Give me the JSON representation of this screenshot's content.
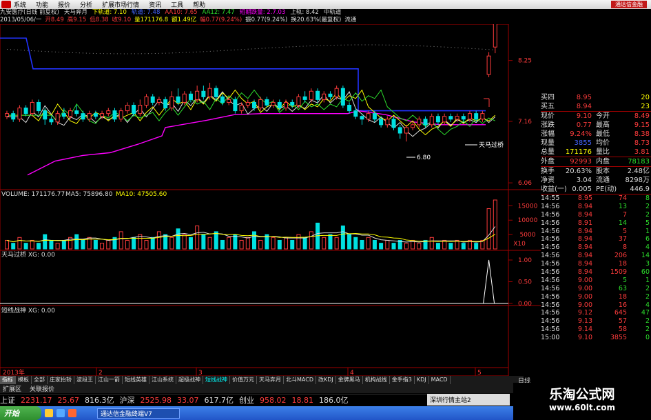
{
  "menu": {
    "items": [
      "系统",
      "功能",
      "报价",
      "分析",
      "扩展市场行情",
      "资讯",
      "工具",
      "帮助"
    ],
    "brand": "通达信金融"
  },
  "header": {
    "line1": [
      {
        "text": "九安医疗(日线 前复权)",
        "c": "w"
      },
      {
        "text": "天马奔月",
        "c": "w"
      },
      {
        "text": "下轨道: 7.10",
        "c": "y"
      },
      {
        "text": "轨道: 7.48",
        "c": "b"
      },
      {
        "text": "AA10: 7.65",
        "c": "r"
      },
      {
        "text": "AA12: 7.47",
        "c": "g"
      },
      {
        "text": "短期跌量: 2.7.03",
        "c": "m"
      },
      {
        "text": "上轨: 8.42",
        "c": "w"
      },
      {
        "text": "中轨道",
        "c": "w"
      }
    ],
    "line2": [
      {
        "text": "2013/05/06/一",
        "c": "w"
      },
      {
        "text": "开8.49",
        "c": "r"
      },
      {
        "text": "高9.15",
        "c": "r"
      },
      {
        "text": "低8.38",
        "c": "r"
      },
      {
        "text": "收9.10",
        "c": "r"
      },
      {
        "text": "量171176.8",
        "c": "y"
      },
      {
        "text": "额1.49亿",
        "c": "y"
      },
      {
        "text": "幅0.77(9.24%)",
        "c": "r"
      },
      {
        "text": "振0.77(9.24%)",
        "c": "w"
      },
      {
        "text": "换20.63%(最复权)",
        "c": "w"
      },
      {
        "text": "流通",
        "c": "w"
      }
    ]
  },
  "price_axis": [
    "8.25",
    "7.16",
    "6.06"
  ],
  "volume_axis": [
    "15000",
    "10000",
    "5000",
    "X10"
  ],
  "xg_axis": [
    "1.00",
    "0.50",
    "0.00"
  ],
  "labels": {
    "volume": "VOLUME: 171176.77",
    "ma5": "MA5: 75896.80",
    "ma10": "MA10: 47505.60",
    "tianma": "天马过桥 XG: 0.00",
    "duanxian": "短线战神 XG: 0.00",
    "annot_tianma": "天马过桥",
    "price_low": "6.80",
    "year": "2013年",
    "months": [
      "2",
      "3",
      "4",
      "5"
    ]
  },
  "panel": {
    "buy_rows": [
      {
        "label": "买四",
        "v1": "8.95",
        "c1": "r",
        "v2": "20",
        "c2": "y"
      },
      {
        "label": "买五",
        "v1": "8.94",
        "c1": "r",
        "v2": "23",
        "c2": "y"
      }
    ],
    "info_rows": [
      {
        "l1": "现价",
        "v1": "9.10",
        "c1": "r",
        "l2": "今开",
        "v2": "8.49",
        "c2": "r"
      },
      {
        "l1": "涨跌",
        "v1": "0.77",
        "c1": "r",
        "l2": "最高",
        "v2": "9.15",
        "c2": "r"
      },
      {
        "l1": "涨幅",
        "v1": "9.24%",
        "c1": "r",
        "l2": "最低",
        "v2": "8.38",
        "c2": "r"
      },
      {
        "l1": "现量",
        "v1": "3855",
        "c1": "b",
        "l2": "均价",
        "v2": "8.73",
        "c2": "r"
      },
      {
        "l1": "总量",
        "v1": "171176",
        "c1": "y",
        "l2": "量比",
        "v2": "3.81",
        "c2": "r"
      },
      {
        "l1": "外盘",
        "v1": "92993",
        "c1": "r",
        "l2": "内盘",
        "v2": "78183",
        "c2": "g"
      },
      {
        "l1": "换手",
        "v1": "20.63%",
        "c1": "w",
        "l2": "股本",
        "v2": "2.48亿",
        "c2": "w"
      },
      {
        "l1": "净资",
        "v1": "3.04",
        "c1": "w",
        "l2": "流通",
        "v2": "8298万",
        "c2": "w"
      },
      {
        "l1": "收益(一)",
        "v1": "0.005",
        "c1": "w",
        "l2": "PE(动)",
        "v2": "446.9",
        "c2": "w"
      }
    ],
    "ticks": [
      {
        "t": "14:55",
        "p": "8.95",
        "pc": "r",
        "q": "74",
        "qc": "r",
        "s": "8",
        "sc": "g"
      },
      {
        "t": "14:56",
        "p": "8.94",
        "pc": "r",
        "q": "13",
        "qc": "g",
        "s": "2",
        "sc": "g"
      },
      {
        "t": "14:56",
        "p": "8.94",
        "pc": "r",
        "q": "7",
        "qc": "r",
        "s": "2",
        "sc": "g"
      },
      {
        "t": "14:56",
        "p": "8.91",
        "pc": "r",
        "q": "14",
        "qc": "g",
        "s": "5",
        "sc": "g"
      },
      {
        "t": "14:56",
        "p": "8.94",
        "pc": "r",
        "q": "5",
        "qc": "r",
        "s": "1",
        "sc": "g"
      },
      {
        "t": "14:56",
        "p": "8.94",
        "pc": "r",
        "q": "37",
        "qc": "r",
        "s": "6",
        "sc": "g"
      },
      {
        "t": "14:56",
        "p": "8.94",
        "pc": "r",
        "q": "8",
        "qc": "r",
        "s": "4",
        "sc": "g"
      },
      {
        "t": "14:56",
        "p": "8.94",
        "pc": "r",
        "q": "206",
        "qc": "r",
        "s": "14",
        "sc": "g"
      },
      {
        "t": "14:56",
        "p": "8.94",
        "pc": "r",
        "q": "18",
        "qc": "r",
        "s": "3",
        "sc": "g"
      },
      {
        "t": "14:56",
        "p": "8.94",
        "pc": "r",
        "q": "1509",
        "qc": "r",
        "s": "60",
        "sc": "g"
      },
      {
        "t": "14:56",
        "p": "9.00",
        "pc": "r",
        "q": "5",
        "qc": "g",
        "s": "1",
        "sc": "g"
      },
      {
        "t": "14:56",
        "p": "9.00",
        "pc": "r",
        "q": "63",
        "qc": "g",
        "s": "2",
        "sc": "g"
      },
      {
        "t": "14:56",
        "p": "9.00",
        "pc": "r",
        "q": "18",
        "qc": "r",
        "s": "2",
        "sc": "g"
      },
      {
        "t": "14:56",
        "p": "9.00",
        "pc": "r",
        "q": "16",
        "qc": "r",
        "s": "4",
        "sc": "g"
      },
      {
        "t": "14:56",
        "p": "9.12",
        "pc": "r",
        "q": "645",
        "qc": "r",
        "s": "47",
        "sc": "g"
      },
      {
        "t": "14:56",
        "p": "9.13",
        "pc": "r",
        "q": "57",
        "qc": "r",
        "s": "2",
        "sc": "g"
      },
      {
        "t": "14:56",
        "p": "9.14",
        "pc": "r",
        "q": "58",
        "qc": "r",
        "s": "2",
        "sc": "g"
      },
      {
        "t": "15:00",
        "p": "9.10",
        "pc": "r",
        "q": "3855",
        "qc": "r",
        "s": "0",
        "sc": "g"
      }
    ]
  },
  "tabs": [
    "指标",
    "模板",
    "全部",
    "庄家抬轿",
    "波段王",
    "江山一箭",
    "短线英雄",
    "江山系统",
    "超级战神",
    "短线战神",
    "价值万元",
    "天马奔月",
    "北斗MACD",
    "改KDJ",
    "金牌黑马",
    "机构战线",
    "金手指3",
    "KDJ",
    "MACD"
  ],
  "active_tab": 0,
  "teal_tab": 9,
  "day_label": "日线",
  "expandbar": [
    "扩展区",
    "关联报价"
  ],
  "indexbar": [
    {
      "text": "上证",
      "c": "w"
    },
    {
      "text": "2231.17",
      "c": "r"
    },
    {
      "text": "25.67",
      "c": "r"
    },
    {
      "text": "816.3亿",
      "c": "w"
    },
    {
      "text": "沪深",
      "c": "w"
    },
    {
      "text": "2525.98",
      "c": "r"
    },
    {
      "text": "33.07",
      "c": "r"
    },
    {
      "text": "617.7亿",
      "c": "w"
    },
    {
      "text": "创业",
      "c": "w"
    },
    {
      "text": "958.02",
      "c": "r"
    },
    {
      "text": "18.81",
      "c": "r"
    },
    {
      "text": "186.0亿",
      "c": "w"
    }
  ],
  "newsbar": "深圳行情主站2",
  "taskbar": {
    "start": "开始",
    "app": "通达信金融终端V7"
  },
  "watermark": {
    "big": "乐淘公式网",
    "small": "www.60lt.com"
  },
  "colors": {
    "up": "#ff3c3c",
    "down": "#00e0e0",
    "ma_white": "#dddddd",
    "ma_yellow": "#ffff00",
    "ma_green": "#2ddf2d",
    "magenta": "#ff00ff",
    "blue": "#2233ff",
    "grid": "#a00000"
  },
  "chart_data": {
    "type": "candlestick",
    "price_range": [
      6.06,
      8.9
    ],
    "candles": [
      [
        7.25,
        7.3,
        7.2,
        7.35
      ],
      [
        7.3,
        7.2,
        7.15,
        7.35
      ],
      [
        7.2,
        7.4,
        7.15,
        7.45
      ],
      [
        7.4,
        7.3,
        7.25,
        7.45
      ],
      [
        7.3,
        7.5,
        7.25,
        7.55
      ],
      [
        7.5,
        7.35,
        7.3,
        7.55
      ],
      [
        7.35,
        7.2,
        7.1,
        7.4
      ],
      [
        7.2,
        7.15,
        7.1,
        7.25
      ],
      [
        7.15,
        7.3,
        7.1,
        7.35
      ],
      [
        7.3,
        7.25,
        7.2,
        7.4
      ],
      [
        7.25,
        7.35,
        7.2,
        7.4
      ],
      [
        7.35,
        7.3,
        7.25,
        7.45
      ],
      [
        7.3,
        7.2,
        7.15,
        7.35
      ],
      [
        7.2,
        7.3,
        7.15,
        7.35
      ],
      [
        7.3,
        7.25,
        7.2,
        7.35
      ],
      [
        7.25,
        7.3,
        7.2,
        7.35
      ],
      [
        7.3,
        7.35,
        7.25,
        7.4
      ],
      [
        7.35,
        7.2,
        7.15,
        7.4
      ],
      [
        7.2,
        7.35,
        7.15,
        7.4
      ],
      [
        7.35,
        7.45,
        7.3,
        7.5
      ],
      [
        7.45,
        7.3,
        7.25,
        7.5
      ],
      [
        7.3,
        7.45,
        7.25,
        7.55
      ],
      [
        7.45,
        7.6,
        7.4,
        7.65
      ],
      [
        7.6,
        7.5,
        7.45,
        7.65
      ],
      [
        7.5,
        7.55,
        7.45,
        7.6
      ],
      [
        7.55,
        7.4,
        7.35,
        7.6
      ],
      [
        7.4,
        7.6,
        7.35,
        7.7
      ],
      [
        7.6,
        7.5,
        7.45,
        7.75
      ],
      [
        7.5,
        7.65,
        7.45,
        7.7
      ],
      [
        7.65,
        7.55,
        7.5,
        7.7
      ],
      [
        7.55,
        7.7,
        7.5,
        7.8
      ],
      [
        7.7,
        7.6,
        7.55,
        7.8
      ],
      [
        7.6,
        7.75,
        7.55,
        7.85
      ],
      [
        7.75,
        7.6,
        7.55,
        7.8
      ],
      [
        7.6,
        7.5,
        7.45,
        7.65
      ],
      [
        7.5,
        7.55,
        7.45,
        7.6
      ],
      [
        7.55,
        7.35,
        7.3,
        7.6
      ],
      [
        7.35,
        7.45,
        7.3,
        7.5
      ],
      [
        7.45,
        7.5,
        7.4,
        7.55
      ],
      [
        7.5,
        7.4,
        7.35,
        7.55
      ],
      [
        7.4,
        7.55,
        7.35,
        7.6
      ],
      [
        7.55,
        7.45,
        7.4,
        7.6
      ],
      [
        7.45,
        7.5,
        7.4,
        7.55
      ],
      [
        7.5,
        7.4,
        7.35,
        7.55
      ],
      [
        7.4,
        7.5,
        7.35,
        7.55
      ],
      [
        7.5,
        7.45,
        7.4,
        7.55
      ],
      [
        7.45,
        7.6,
        7.4,
        7.65
      ],
      [
        7.6,
        7.55,
        7.5,
        7.7
      ],
      [
        7.55,
        7.7,
        7.5,
        7.75
      ],
      [
        7.7,
        7.55,
        7.5,
        7.75
      ],
      [
        7.55,
        7.65,
        7.5,
        7.7
      ],
      [
        7.65,
        7.6,
        7.55,
        7.7
      ],
      [
        7.6,
        7.75,
        7.55,
        7.8
      ],
      [
        7.75,
        7.45,
        7.4,
        7.8
      ],
      [
        7.45,
        7.35,
        7.3,
        7.5
      ],
      [
        7.35,
        7.25,
        7.2,
        7.4
      ],
      [
        7.25,
        7.2,
        7.1,
        7.3
      ],
      [
        7.2,
        7.3,
        7.15,
        7.35
      ],
      [
        7.3,
        7.2,
        7.15,
        7.35
      ],
      [
        7.2,
        7.1,
        7.05,
        7.25
      ],
      [
        7.1,
        7.2,
        7.05,
        7.25
      ],
      [
        7.2,
        7.05,
        7.0,
        7.25
      ],
      [
        7.05,
        6.95,
        6.85,
        7.1
      ],
      [
        6.95,
        7.05,
        6.8,
        7.1
      ],
      [
        7.05,
        7.1,
        7.0,
        7.15
      ],
      [
        7.1,
        7.2,
        7.05,
        7.25
      ],
      [
        7.2,
        7.1,
        7.05,
        7.25
      ],
      [
        7.1,
        7.25,
        7.05,
        7.3
      ],
      [
        7.25,
        7.15,
        7.1,
        7.3
      ],
      [
        7.15,
        7.25,
        7.1,
        7.3
      ],
      [
        7.25,
        7.2,
        7.15,
        7.3
      ],
      [
        7.2,
        7.25,
        7.15,
        7.3
      ],
      [
        7.25,
        7.2,
        7.15,
        7.3
      ],
      [
        7.2,
        7.3,
        7.15,
        7.35
      ],
      [
        7.3,
        7.2,
        7.15,
        7.35
      ],
      [
        7.2,
        7.3,
        7.15,
        7.35
      ],
      [
        8.0,
        8.33,
        7.95,
        8.4
      ],
      [
        8.49,
        9.1,
        8.38,
        9.15
      ]
    ],
    "volumes": [
      3,
      2,
      4,
      2,
      3,
      2,
      5,
      3,
      2,
      3,
      4,
      5,
      3,
      4,
      3,
      2,
      3,
      4,
      6,
      3,
      4,
      5,
      3,
      4,
      6,
      5,
      4,
      7,
      5,
      4,
      8,
      5,
      4,
      6,
      3,
      4,
      5,
      3,
      4,
      6,
      3,
      5,
      4,
      3,
      4,
      3,
      5,
      4,
      6,
      9,
      4,
      5,
      4,
      8,
      5,
      4,
      3,
      4,
      3,
      2,
      3,
      2,
      3,
      2,
      3,
      2,
      3,
      4,
      2,
      3,
      2,
      3,
      2,
      3,
      2,
      3,
      14,
      17
    ]
  }
}
